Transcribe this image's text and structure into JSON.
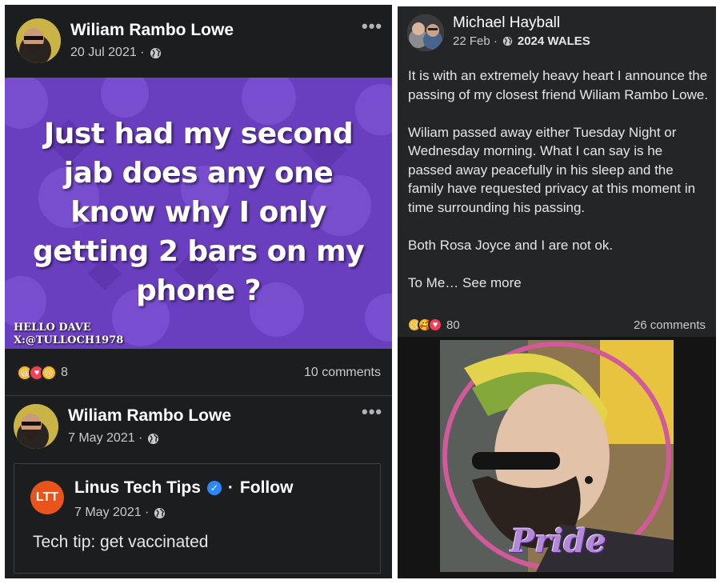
{
  "left_post": {
    "author": "Wiliam Rambo Lowe",
    "date": "20 Jul 2021 ·",
    "more_icon": "•••",
    "meme": {
      "text": "Just had my second jab does any one know why I only getting 2 bars on my phone ?",
      "credit_line1": "HELLO DAVE",
      "credit_line2": "X:@TULLOCH1978",
      "background_color": "#6a3fbf"
    },
    "reactions": {
      "icons": [
        "laugh-icon",
        "love-icon",
        "sad-icon"
      ],
      "count": "8"
    },
    "comments": "10 comments"
  },
  "second_post": {
    "author": "Wiliam Rambo Lowe",
    "date": "7 May 2021 ·",
    "more_icon": "•••",
    "shared": {
      "page_name": "Linus Tech Tips",
      "follow_prefix": "·",
      "follow_label": "Follow",
      "date": "7 May 2021 ·",
      "logo_text": "LTT",
      "text": "Tech tip: get vaccinated"
    }
  },
  "right_post": {
    "author": "Michael Hayball",
    "date": "22 Feb ·",
    "location": "2024 WALES",
    "paragraphs": [
      "It is with an extremely heavy heart I announce the passing of my closest friend Wiliam Rambo Lowe.",
      "Wiliam passed away either Tuesday Night or Wednesday morning.  What I can say is he passed away peacefully in his sleep and the family have requested privacy at this moment in time surrounding his passing.",
      "Both Rosa Joyce and I are not ok."
    ],
    "truncated": "To Me…",
    "see_more": "See more",
    "reactions": {
      "icons": [
        "sad-icon",
        "care-icon",
        "love-icon"
      ],
      "count": "80"
    },
    "comments": "26 comments",
    "photo_overlay": "Pride"
  },
  "colors": {
    "card_bg": "#242526",
    "text_primary": "#e4e6eb",
    "text_secondary": "#c8cacd",
    "verified_blue": "#2d88ff",
    "ltt_orange": "#e8541c"
  }
}
